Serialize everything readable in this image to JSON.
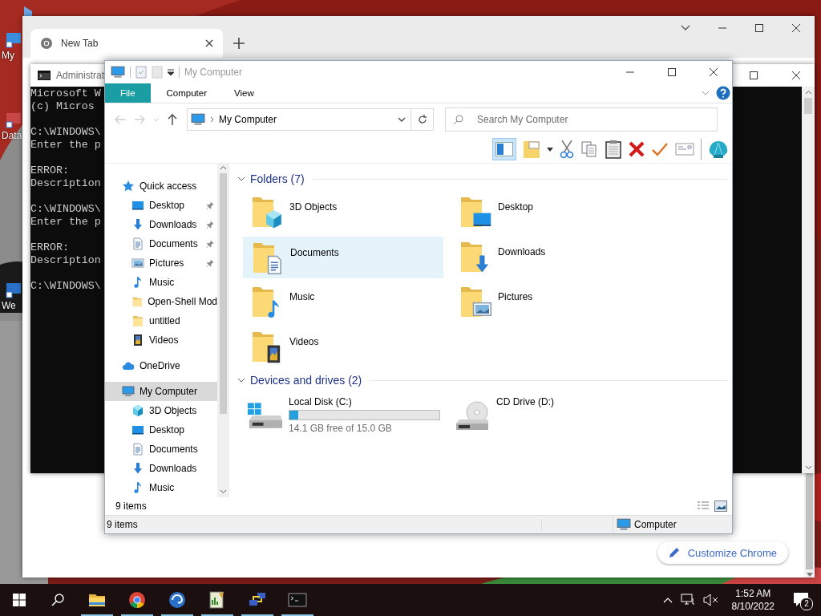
{
  "desktop": {
    "icons": [
      {
        "label": "My"
      },
      {
        "label": "Data"
      },
      {
        "label": "We"
      }
    ]
  },
  "browser": {
    "tabs": [
      {
        "label": "New Tab",
        "selected": true
      }
    ],
    "customize_button": "Customize Chrome"
  },
  "console": {
    "title": "Administrat",
    "blocks": [
      [
        "Microsoft W",
        "(c) Micros"
      ],
      [
        "C:\\WINDOWS\\",
        "Enter the p"
      ],
      [
        "ERROR:",
        "Description"
      ],
      [
        "C:\\WINDOWS\\",
        "Enter the p"
      ],
      [
        "ERROR:",
        "Description"
      ],
      [
        "C:\\WINDOWS\\"
      ]
    ]
  },
  "explorer": {
    "title": "My Computer",
    "ribbon_tabs": [
      {
        "label": "File",
        "selected": true
      },
      {
        "label": "Computer",
        "selected": false
      },
      {
        "label": "View",
        "selected": false
      }
    ],
    "address": "My Computer",
    "search": {
      "placeholder": "Search My Computer"
    },
    "toolbar": {
      "pane_toggle_on": true
    },
    "nav": [
      {
        "label": "Quick access",
        "kind": "star",
        "selected": false,
        "children": [
          {
            "label": "Desktop",
            "kind": "desktop",
            "pinned": true,
            "selected": false
          },
          {
            "label": "Downloads",
            "kind": "downloads",
            "pinned": true,
            "selected": false
          },
          {
            "label": "Documents",
            "kind": "documents",
            "pinned": true,
            "selected": false
          },
          {
            "label": "Pictures",
            "kind": "pictures",
            "pinned": true,
            "selected": false
          },
          {
            "label": "Music",
            "kind": "music",
            "pinned": false,
            "selected": false
          },
          {
            "label": "Open-Shell Mod",
            "kind": "folder",
            "pinned": false,
            "selected": false
          },
          {
            "label": "untitled",
            "kind": "folder",
            "pinned": false,
            "selected": false
          },
          {
            "label": "Videos",
            "kind": "videos",
            "pinned": false,
            "selected": false
          }
        ]
      },
      {
        "label": "OneDrive",
        "kind": "cloud",
        "selected": false
      },
      {
        "label": "My Computer",
        "kind": "computer",
        "selected": true,
        "children": [
          {
            "label": "3D Objects",
            "kind": "objects3d",
            "selected": false
          },
          {
            "label": "Desktop",
            "kind": "desktop",
            "selected": false
          },
          {
            "label": "Documents",
            "kind": "documents",
            "selected": false
          },
          {
            "label": "Downloads",
            "kind": "downloads",
            "selected": false
          },
          {
            "label": "Music",
            "kind": "music",
            "selected": false
          }
        ]
      }
    ],
    "groups": [
      {
        "title": "Folders (7)",
        "expanded": true,
        "items": [
          {
            "label": "3D Objects",
            "kind": "objects3d",
            "selected": false
          },
          {
            "label": "Desktop",
            "kind": "desktop",
            "selected": false
          },
          {
            "label": "Documents",
            "kind": "documents",
            "selected": true
          },
          {
            "label": "Downloads",
            "kind": "downloads",
            "selected": false
          },
          {
            "label": "Music",
            "kind": "music",
            "selected": false
          },
          {
            "label": "Pictures",
            "kind": "pictures",
            "selected": false
          },
          {
            "label": "Videos",
            "kind": "videos",
            "selected": false
          }
        ]
      },
      {
        "title": "Devices and drives (2)",
        "expanded": true,
        "items": [
          {
            "label": "Local Disk (C:)",
            "kind": "disk",
            "level": 0.06,
            "reading": "14.1 GB free of 15.0 GB"
          },
          {
            "label": "CD Drive (D:)",
            "kind": "cd"
          }
        ]
      }
    ],
    "item_count": "9 items",
    "status_bar": {
      "count": "9 items",
      "location": "Computer"
    }
  },
  "taskbar": {
    "apps": [
      {
        "kind": "explorer",
        "running": true
      },
      {
        "kind": "browser",
        "running": true
      },
      {
        "kind": "globe",
        "running": true
      },
      {
        "kind": "notepad",
        "running": true
      },
      {
        "kind": "network",
        "running": true
      },
      {
        "kind": "terminal",
        "running": true
      }
    ],
    "volume_muted": true,
    "time": "1:52 AM",
    "date": "8/10/2022",
    "notifications": "2"
  }
}
